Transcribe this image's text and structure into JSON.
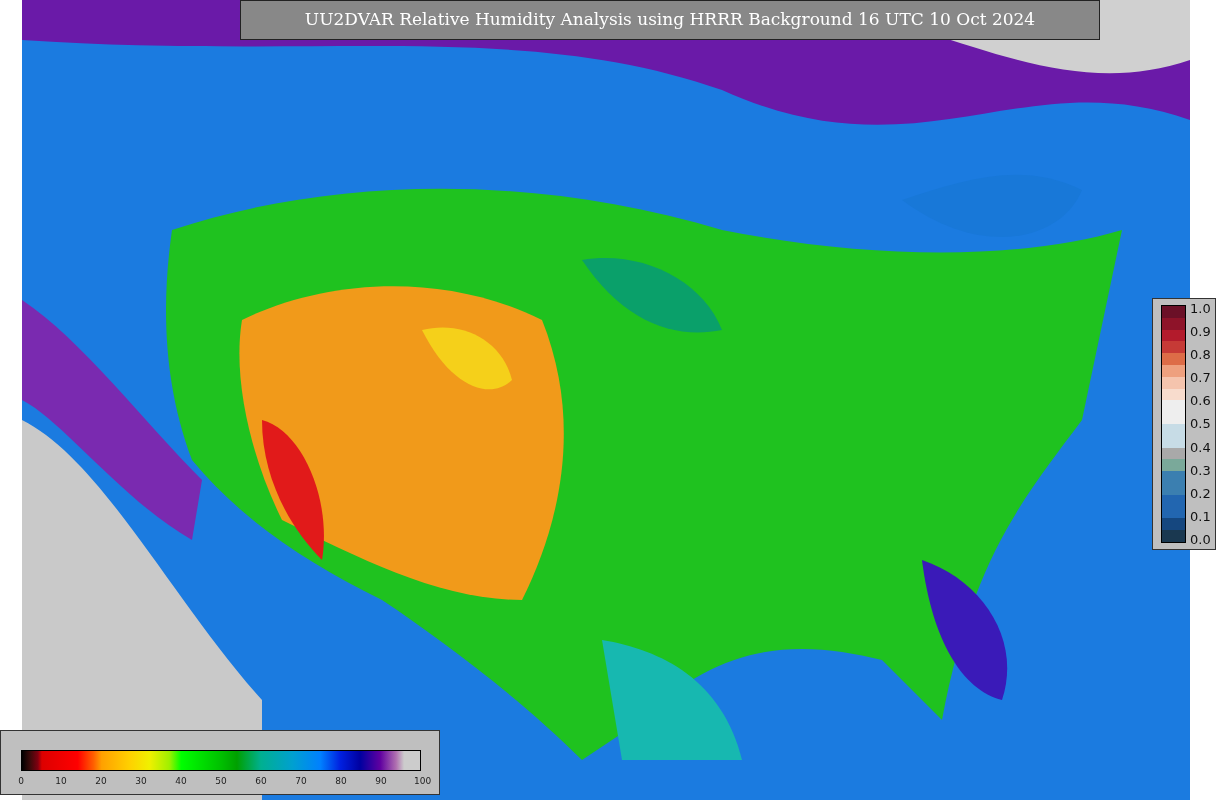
{
  "title": "UU2DVAR Relative Humidity Analysis using HRRR Background 16 UTC 10 Oct 2024",
  "colorbars": [
    {
      "kind": "vertical",
      "ticks": [
        "1.0",
        "0.9",
        "0.8",
        "0.7",
        "0.6",
        "0.5",
        "0.4",
        "0.3",
        "0.2",
        "0.1",
        "0.0"
      ]
    },
    {
      "kind": "horizontal",
      "ticks": [
        "0",
        "10",
        "20",
        "30",
        "40",
        "50",
        "60",
        "70",
        "80",
        "90",
        "100"
      ]
    }
  ]
}
